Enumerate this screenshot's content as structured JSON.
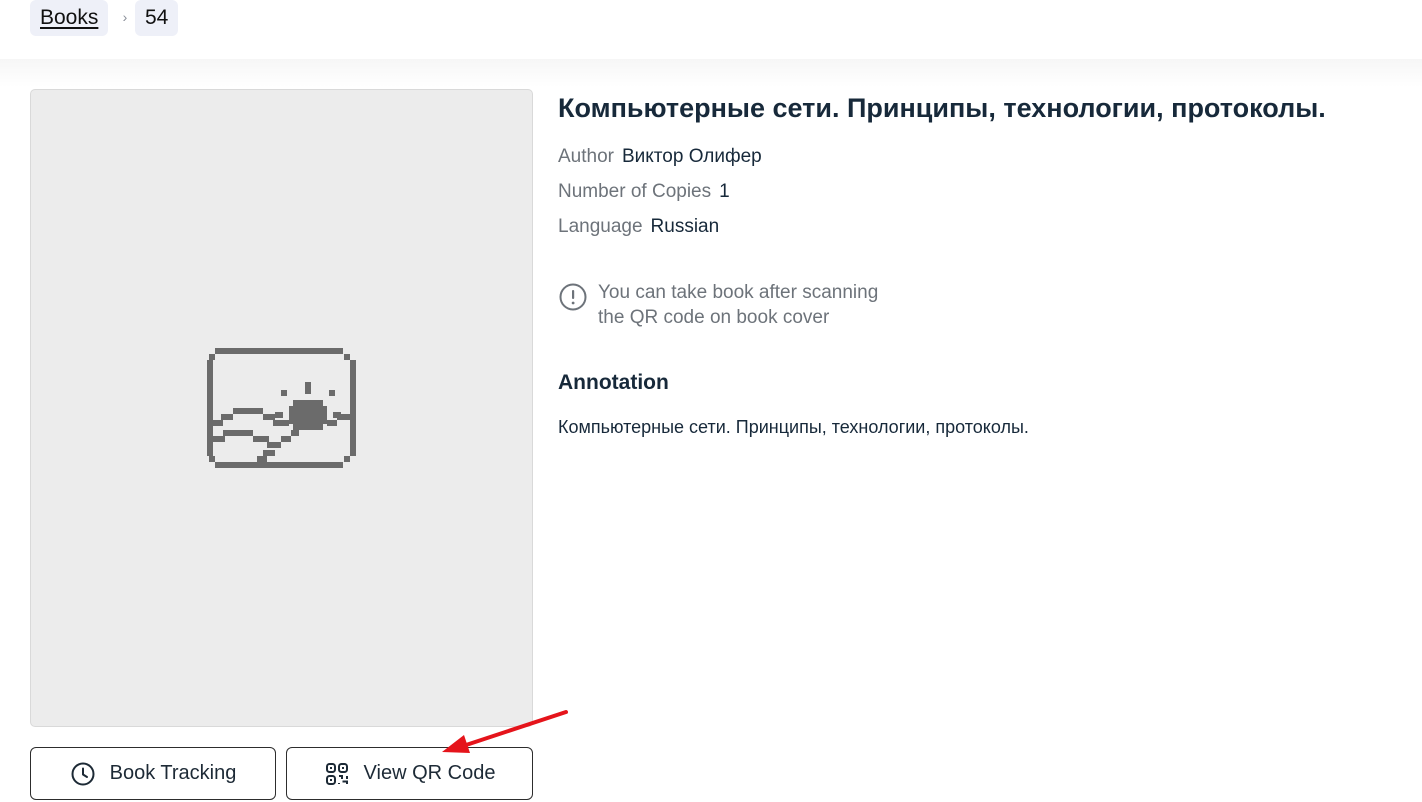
{
  "breadcrumb": {
    "root_label": "Books",
    "separator": "›",
    "current_label": "54"
  },
  "book": {
    "title": "Компьютерные сети. Принципы, технологии, протоколы.",
    "author_label": "Author",
    "author_value": "Виктор Олифер",
    "copies_label": "Number of Copies",
    "copies_value": "1",
    "language_label": "Language",
    "language_value": "Russian",
    "cover_icon": "image-placeholder-icon"
  },
  "notice": {
    "icon": "info-circle-icon",
    "line1": "You can take book after scanning",
    "line2": "the QR code on book cover"
  },
  "annotation": {
    "heading": "Annotation",
    "text": "Компьютерные сети. Принципы, технологии, протоколы."
  },
  "actions": {
    "tracking_label": "Book Tracking",
    "tracking_icon": "clock-icon",
    "qr_label": "View QR Code",
    "qr_icon": "qr-code-icon"
  },
  "annotation_overlay": {
    "arrow_color": "#e5141b"
  },
  "colors": {
    "text_dark": "#17293a",
    "text_muted": "#6d737a",
    "breadcrumb_bg": "#eef0f8",
    "cover_bg": "#ececec"
  }
}
